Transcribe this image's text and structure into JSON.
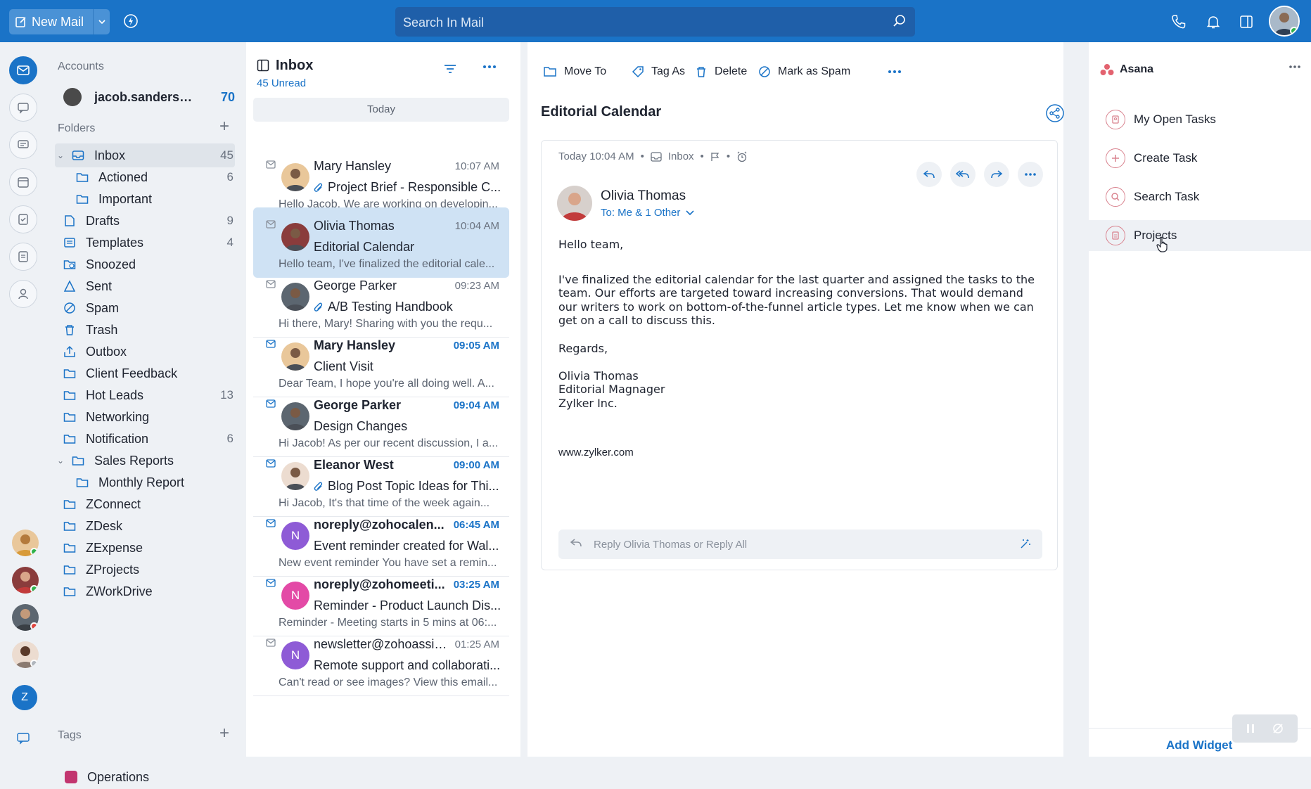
{
  "topbar": {
    "new_mail": "New Mail",
    "search_placeholder": "Search In Mail"
  },
  "folders": {
    "accounts_label": "Accounts",
    "account_email": "jacob.sanders@zy...",
    "account_count": "70",
    "folders_label": "Folders",
    "items": [
      {
        "label": "Inbox",
        "count": "45"
      },
      {
        "label": "Actioned",
        "count": "6"
      },
      {
        "label": "Important",
        "count": ""
      },
      {
        "label": "Drafts",
        "count": "9"
      },
      {
        "label": "Templates",
        "count": "4"
      },
      {
        "label": "Snoozed",
        "count": ""
      },
      {
        "label": "Sent",
        "count": ""
      },
      {
        "label": "Spam",
        "count": ""
      },
      {
        "label": "Trash",
        "count": ""
      },
      {
        "label": "Outbox",
        "count": ""
      },
      {
        "label": "Client Feedback",
        "count": ""
      },
      {
        "label": "Hot Leads",
        "count": "13"
      },
      {
        "label": "Networking",
        "count": ""
      },
      {
        "label": "Notification",
        "count": "6"
      },
      {
        "label": "Sales Reports",
        "count": ""
      },
      {
        "label": "Monthly Report",
        "count": ""
      },
      {
        "label": "ZConnect",
        "count": ""
      },
      {
        "label": "ZDesk",
        "count": ""
      },
      {
        "label": "ZExpense",
        "count": ""
      },
      {
        "label": "ZProjects",
        "count": ""
      },
      {
        "label": "ZWorkDrive",
        "count": ""
      }
    ],
    "tags_label": "Tags",
    "tags": [
      {
        "label": "Operations",
        "color": "#c2356f"
      }
    ]
  },
  "rail": {
    "avatar_initial": "Z"
  },
  "list": {
    "title": "Inbox",
    "unread": "45 Unread",
    "today": "Today",
    "messages": [
      {
        "from": "Mary Hansley",
        "time": "10:07 AM",
        "subject": "Project Brief - Responsible C...",
        "preview": "Hello Jacob, We are working on developin...",
        "unread": false,
        "attachment": true
      },
      {
        "from": "Olivia Thomas",
        "time": "10:04 AM",
        "subject": "Editorial Calendar",
        "preview": "Hello team, I've finalized the editorial cale...",
        "unread": false,
        "attachment": false
      },
      {
        "from": "George Parker",
        "time": "09:23 AM",
        "subject": "A/B Testing Handbook",
        "preview": "Hi there, Mary! Sharing with you the requ...",
        "unread": false,
        "attachment": true
      },
      {
        "from": "Mary Hansley",
        "time": "09:05 AM",
        "subject": "Client Visit",
        "preview": "Dear Team, I hope you're all doing well. A...",
        "unread": true,
        "attachment": false
      },
      {
        "from": "George Parker",
        "time": "09:04 AM",
        "subject": "Design Changes",
        "preview": "Hi Jacob! As per our recent discussion, I a...",
        "unread": true,
        "attachment": false
      },
      {
        "from": "Eleanor West",
        "time": "09:00 AM",
        "subject": "Blog Post Topic Ideas for Thi...",
        "preview": "Hi Jacob, It's that time of the week again...",
        "unread": true,
        "attachment": true
      },
      {
        "from": "noreply@zohocalen...",
        "time": "06:45 AM",
        "subject": "Event reminder created for Wal...",
        "preview": "New event reminder You have set a remin...",
        "unread": true,
        "attachment": false,
        "initial": "N",
        "color": "#8e5bd6"
      },
      {
        "from": "noreply@zohomeeti...",
        "time": "03:25 AM",
        "subject": "Reminder - Product Launch Dis...",
        "preview": "Reminder - Meeting starts in 5 mins at 06:...",
        "unread": true,
        "attachment": false,
        "initial": "N",
        "color": "#e34aa6"
      },
      {
        "from": "newsletter@zohoassist...",
        "time": "01:25 AM",
        "subject": "Remote support and collaborati...",
        "preview": "Can't read or see images? View this email...",
        "unread": false,
        "attachment": false,
        "initial": "N",
        "color": "#8e5bd6"
      }
    ]
  },
  "reader": {
    "toolbar": {
      "move_to": "Move To",
      "tag_as": "Tag As",
      "delete": "Delete",
      "mark_spam": "Mark as Spam"
    },
    "title": "Editorial Calendar",
    "meta_time": "Today 10:04 AM",
    "meta_folder": "Inbox",
    "sender": "Olivia Thomas",
    "to": "To: Me & 1 Other",
    "greeting": "Hello team,",
    "paragraph": "I've finalized the editorial calendar for the last quarter and assigned the tasks to the team. Our efforts are targeted toward increasing conversions. That would demand our writers to work on bottom-of-the-funnel article types. Let me know when we can get on a call to discuss this.",
    "regards": "Regards,",
    "sig_name": "Olivia Thomas",
    "sig_title": "Editorial Magnager",
    "sig_company": "Zylker Inc.",
    "website": "www.zylker.com",
    "reply_placeholder": "Reply Olivia Thomas or Reply All"
  },
  "widget": {
    "title": "Asana",
    "items": [
      "My Open Tasks",
      "Create Task",
      "Search Task",
      "Projects"
    ],
    "add_widget": "Add Widget"
  },
  "colors": {
    "brand": "#1a73c7",
    "selected_row": "#cfe2f4",
    "asana": "#e3626f"
  }
}
